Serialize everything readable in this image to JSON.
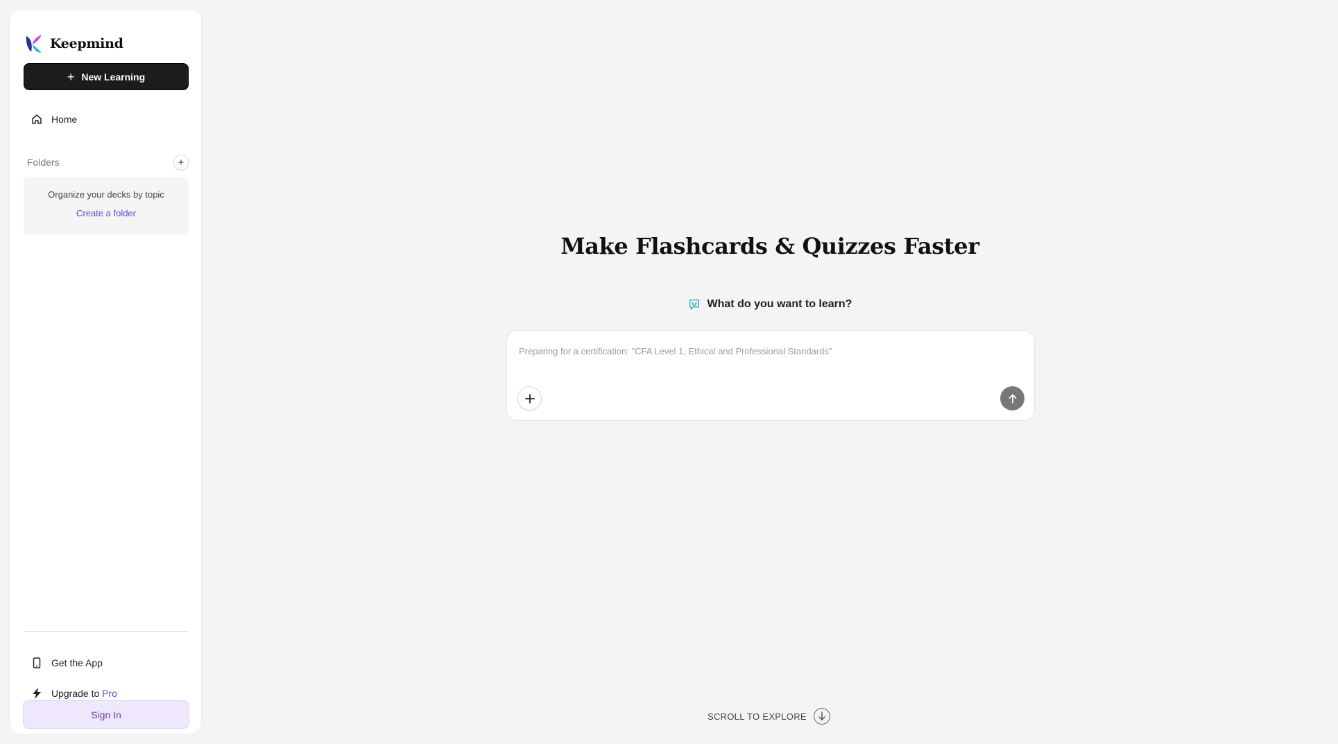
{
  "brand": {
    "name": "Keepmind",
    "logo_icon": "keepmind-logo-icon"
  },
  "sidebar": {
    "new_button": {
      "label": "New Learning",
      "icon": "plus-icon"
    },
    "home": {
      "label": "Home",
      "icon": "home-icon"
    },
    "folders": {
      "label": "Folders",
      "add_icon": "plus-icon",
      "empty_hint": "Organize your decks by topic",
      "create_link": "Create a folder"
    },
    "get_app": {
      "label": "Get the App",
      "icon": "phone-icon"
    },
    "upgrade": {
      "label": "Upgrade to",
      "highlight": "Pro",
      "icon": "lightning-icon"
    },
    "sign_in": "Sign In"
  },
  "main": {
    "headline": "Make Flashcards & Quizzes Faster",
    "prompt_label": "What do you want to learn?",
    "prompt_icon": "chat-bubble-icon",
    "input": {
      "value": "",
      "placeholder": "Preparing for a certification: \"CFA Level 1, Ethical and Professional Standards\""
    },
    "attach_icon": "plus-icon",
    "send_icon": "arrow-up-icon",
    "scroll_hint": "SCROLL TO EXPLORE",
    "scroll_icon": "arrow-down-circle-icon"
  },
  "colors": {
    "accent_purple": "#6a45c8",
    "dark_button": "#1c1c1c",
    "signin_bg": "#efe8fc",
    "prompt_icon": "#3aa8c9"
  }
}
